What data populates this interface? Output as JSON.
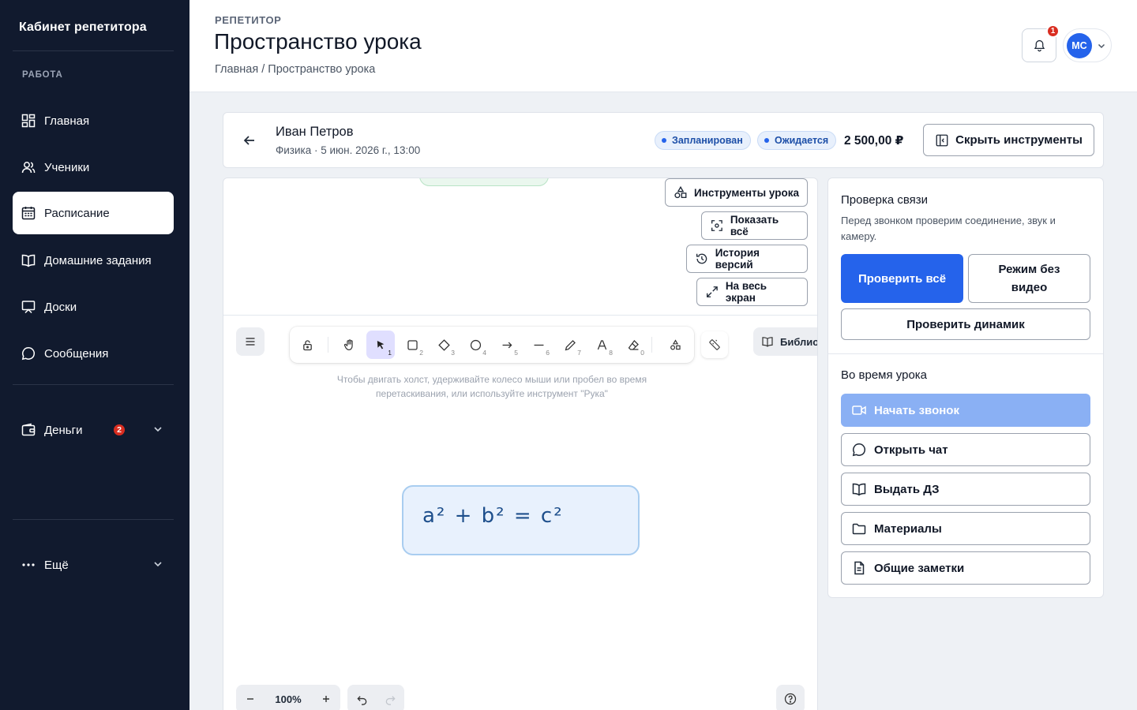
{
  "sidebar": {
    "brand": "Кабинет репетитора",
    "section": "РАБОТА",
    "items": [
      {
        "label": "Главная",
        "icon": "grid-icon"
      },
      {
        "label": "Ученики",
        "icon": "users-icon"
      },
      {
        "label": "Расписание",
        "icon": "calendar-icon",
        "active": true
      },
      {
        "label": "Домашние задания",
        "icon": "book-icon"
      },
      {
        "label": "Доски",
        "icon": "presentation-icon"
      },
      {
        "label": "Сообщения",
        "icon": "message-icon"
      }
    ],
    "money": {
      "label": "Деньги",
      "badge": "2"
    },
    "more": {
      "label": "Ещё"
    }
  },
  "header": {
    "eyebrow": "РЕПЕТИТОР",
    "title": "Пространство урока",
    "breadcrumb": "Главная / Пространство урока",
    "notifications": "1",
    "avatar": "МС"
  },
  "lesson": {
    "student": "Иван Петров",
    "meta": "Физика · 5 июн. 2026 г., 13:00",
    "status_planned": "Запланирован",
    "status_waiting": "Ожидается",
    "price": "2 500,00 ₽",
    "hide_tools": "Скрыть инструменты"
  },
  "board": {
    "tools_button": "Инструменты урока",
    "show_all": "Показать всё",
    "history": "История версий",
    "fullscreen": "На весь экран",
    "library": "Библио",
    "hint": "Чтобы двигать холст, удерживайте колесо мыши или пробел во время перетаскивания, или используйте инструмент \"Рука\"",
    "formula": "a² + b² = c²",
    "zoom": "100%",
    "toolbar_numbers": [
      "1",
      "2",
      "3",
      "4",
      "5",
      "6",
      "7",
      "8",
      "0"
    ]
  },
  "panel": {
    "check_title": "Проверка связи",
    "check_desc": "Перед звонком проверим соединение, звук и камеру.",
    "check_all": "Проверить всё",
    "no_video": "Режим без видео",
    "check_speaker": "Проверить динамик",
    "during_title": "Во время урока",
    "start_call": "Начать звонок",
    "open_chat": "Открыть чат",
    "assign_hw": "Выдать ДЗ",
    "materials": "Материалы",
    "notes": "Общие заметки"
  },
  "colors": {
    "sidebar_bg": "#111a2e",
    "accent": "#2563eb",
    "badge": "#d92d20",
    "call_disabled": "#8ab0f4"
  }
}
